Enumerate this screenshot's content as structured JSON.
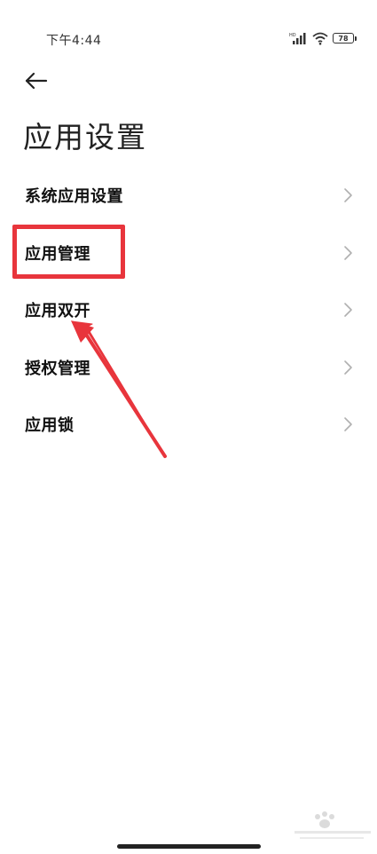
{
  "status_bar": {
    "time": "下午4:44",
    "signal_badge": "HD",
    "battery_level": "78"
  },
  "header": {
    "title": "应用设置"
  },
  "menu": {
    "items": [
      {
        "label": "系统应用设置"
      },
      {
        "label": "应用管理"
      },
      {
        "label": "应用双开"
      },
      {
        "label": "授权管理"
      },
      {
        "label": "应用锁"
      }
    ]
  },
  "annotation": {
    "highlighted_item": "应用管理",
    "highlight_color": "#e8353c"
  },
  "icons": {
    "back": "back-arrow-icon",
    "chevron": "chevron-right-icon",
    "signal": "cellular-signal-icon",
    "wifi": "wifi-icon",
    "battery": "battery-icon"
  }
}
